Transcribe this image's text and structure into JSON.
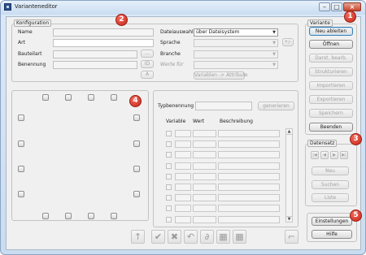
{
  "window": {
    "title": "Varianteneditor"
  },
  "konfiguration": {
    "legend": "Konfiguration",
    "labels": {
      "name": "Name",
      "art": "Art",
      "bauteilart": "Bauteilart",
      "benennung": "Benennung"
    },
    "dots_button": "...",
    "id_button": "ID",
    "a_button": "A",
    "dateiauswahl_label": "Dateiauswahl",
    "dateiauswahl_value": "über Dateisystem",
    "sprache_label": "Sprache",
    "branche_label": "Branche",
    "werte_fuer_label": "Werte für",
    "plusminus_button": "+/-",
    "variablen_attribute_button": "Variablen -> Attribute"
  },
  "variante": {
    "legend": "Variante",
    "buttons": [
      "Neu ableiten",
      "Öffnen",
      "Darst. bearb.",
      "Strukturieren",
      "Importieren",
      "Exportieren",
      "Speichern",
      "Beenden"
    ]
  },
  "datensatz": {
    "legend": "Datensatz",
    "nav": [
      "|◀",
      "◀",
      "▶",
      "▶|"
    ],
    "buttons": [
      "Neu",
      "Suchen",
      "Liste"
    ]
  },
  "settings": {
    "buttons": [
      "Einstellungen",
      "Hilfe"
    ]
  },
  "typ": {
    "label": "Typbenennung",
    "generate_button": "generieren",
    "columns": [
      "Variable",
      "Wert",
      "Beschreibung"
    ]
  },
  "badges": [
    "1",
    "2",
    "3",
    "4",
    "5"
  ],
  "toolbar": {
    "icons": [
      "arrow-up-icon",
      "check-icon",
      "delete-icon",
      "undo-icon",
      "formula-icon",
      "table-add-icon",
      "table-remove-icon",
      "corner-icon"
    ],
    "glyphs": [
      "↑",
      "✔",
      "✖",
      "↶",
      "∂",
      "▦",
      "▦",
      "⌐"
    ]
  },
  "colors": {
    "badge": "#d0301f",
    "primary_border": "#3c7fb1"
  }
}
